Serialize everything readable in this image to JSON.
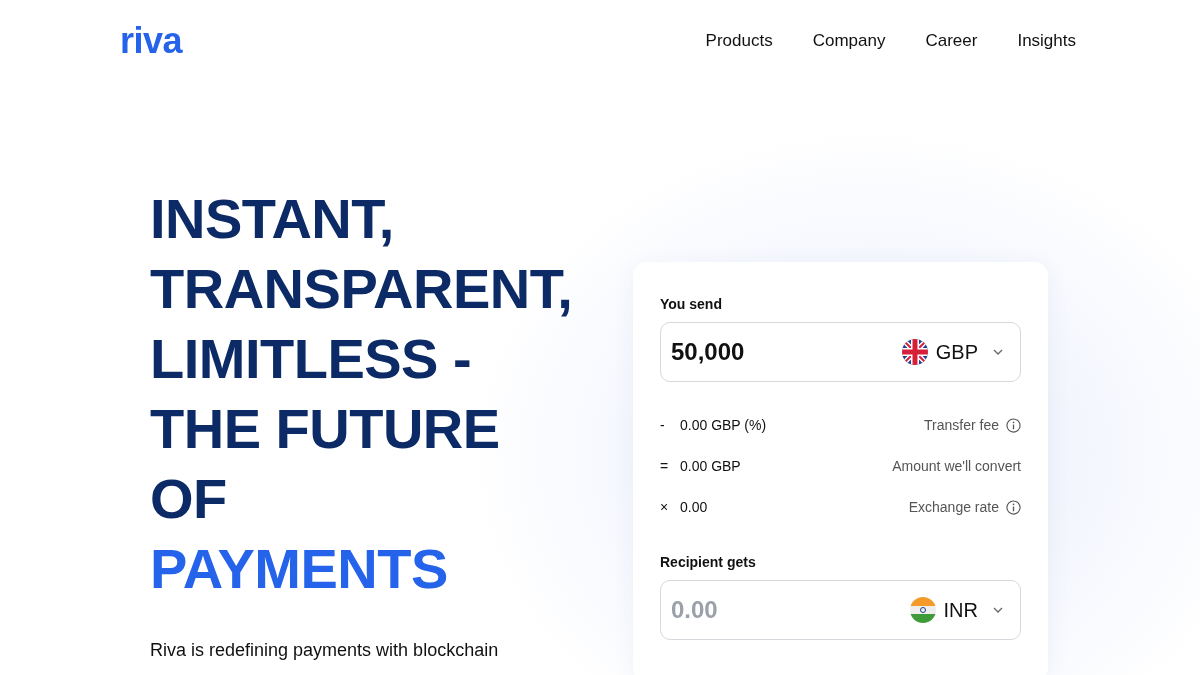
{
  "logo": "riva",
  "nav": [
    "Products",
    "Company",
    "Career",
    "Insights"
  ],
  "hero": {
    "heading_lines": [
      {
        "text": "INSTANT,",
        "highlight": false
      },
      {
        "text": "TRANSPARENT,",
        "highlight": false
      },
      {
        "text": "LIMITLESS -",
        "highlight": false
      },
      {
        "text": "THE FUTURE",
        "highlight": false
      },
      {
        "text": "OF",
        "highlight": false
      },
      {
        "text": "PAYMENTS",
        "highlight": true
      }
    ],
    "description": "Riva is redefining payments with blockchain"
  },
  "converter": {
    "fields": [
      {
        "kind": "uk",
        "label": "You send",
        "value": "50,000",
        "currency": "GBP"
      },
      {
        "kind": "india",
        "label": "Recipient gets",
        "placeholder": "0.00",
        "currency": "INR"
      }
    ],
    "breakdown": [
      {
        "sign": "-",
        "value": "0.00 GBP (%)",
        "label": "Transfer fee",
        "info": true
      },
      {
        "sign": "=",
        "value": "0.00 GBP",
        "label": "Amount we'll convert",
        "info": false
      },
      {
        "sign": "×",
        "value": "0.00",
        "label": "Exchange rate",
        "info": true
      }
    ]
  }
}
